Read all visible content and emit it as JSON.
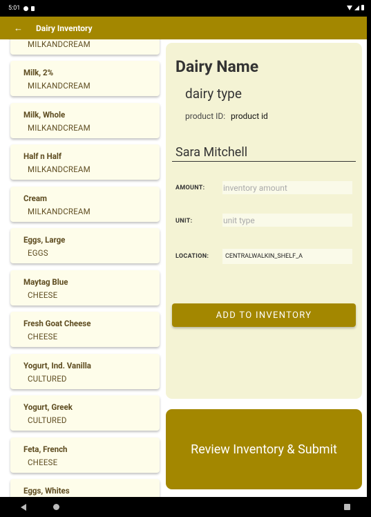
{
  "status_bar": {
    "time": "5:01"
  },
  "app_bar": {
    "title": "Dairy Inventory"
  },
  "items": [
    {
      "name": "Milk, 2%",
      "type": "MILKANDCREAM"
    },
    {
      "name": "Milk, Whole",
      "type": "MILKANDCREAM"
    },
    {
      "name": "Half n Half",
      "type": "MILKANDCREAM"
    },
    {
      "name": "Cream",
      "type": "MILKANDCREAM"
    },
    {
      "name": "Eggs, Large",
      "type": "EGGS"
    },
    {
      "name": "Maytag Blue",
      "type": "CHEESE"
    },
    {
      "name": "Fresh Goat Cheese",
      "type": "CHEESE"
    },
    {
      "name": "Yogurt, Ind. Vanilla",
      "type": "CULTURED"
    },
    {
      "name": "Yogurt, Greek",
      "type": "CULTURED"
    },
    {
      "name": "Feta, French",
      "type": "CHEESE"
    },
    {
      "name": "Eggs, Whites",
      "type": ""
    }
  ],
  "partial_top_item": {
    "type": "MILKANDCREAM"
  },
  "detail": {
    "dairy_name": "Dairy Name",
    "dairy_type": "dairy type",
    "product_id_label": "product ID:",
    "product_id_value": "product id",
    "user_name": "Sara Mitchell",
    "amount_label": "AMOUNT:",
    "amount_placeholder": "inventory amount",
    "unit_label": "UNIT:",
    "unit_placeholder": "unit type",
    "location_label": "LOCATION:",
    "location_value": "CENTRALWALKIN_SHELF_A",
    "add_button": "ADD TO INVENTORY"
  },
  "review_button": "Review Inventory & Submit",
  "colors": {
    "accent": "#a38700",
    "card": "#fefdea",
    "panel": "#f4f3d4",
    "item_text": "#5d4b1f"
  }
}
